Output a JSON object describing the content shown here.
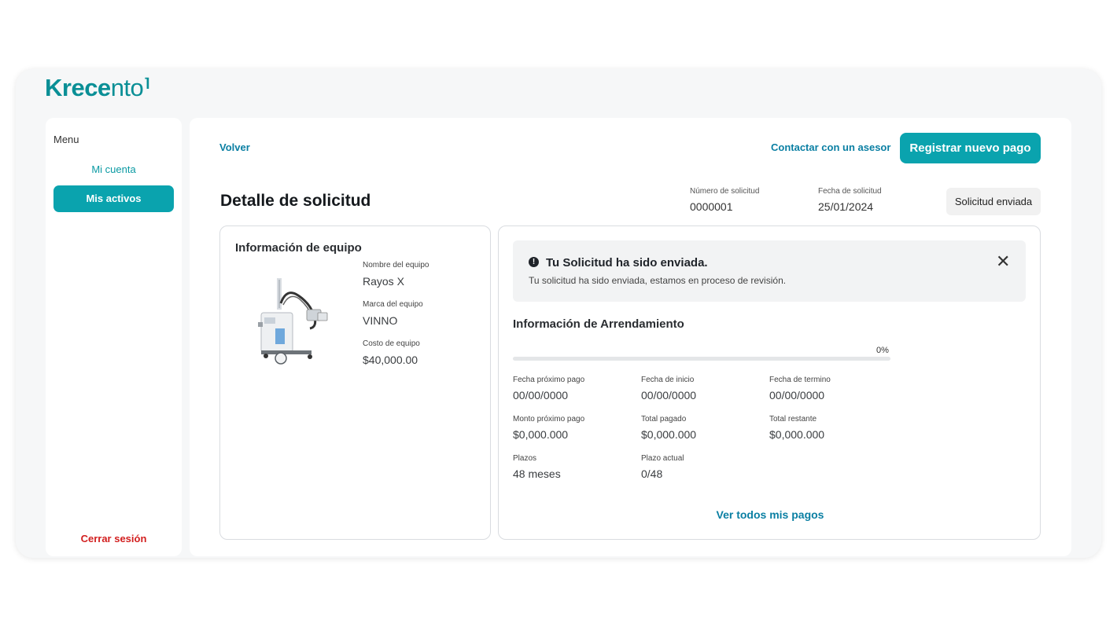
{
  "brand": {
    "bold": "Krece",
    "light": "nto",
    "mark": "⌉"
  },
  "sidebar": {
    "menu_label": "Menu",
    "items": [
      {
        "label": "Mi cuenta",
        "active": false
      },
      {
        "label": "Mis activos",
        "active": true
      }
    ],
    "logout_label": "Cerrar sesión"
  },
  "header": {
    "back_label": "Volver",
    "contact_label": "Contactar con un asesor",
    "primary_button_label": "Registrar nuevo pago",
    "title": "Detalle de solicitud",
    "request_number_label": "Número de solicitud",
    "request_number": "0000001",
    "request_date_label": "Fecha de solicitud",
    "request_date": "25/01/2024",
    "status": "Solicitud enviada"
  },
  "equipment": {
    "title": "Información de equipo",
    "name_label": "Nombre del equipo",
    "name": "Rayos X",
    "brand_label": "Marca del equipo",
    "brand": "VINNO",
    "cost_label": "Costo de equipo",
    "cost": "$40,000.00"
  },
  "lease": {
    "alert_title": "Tu Solicitud ha sido enviada.",
    "alert_body": "Tu solicitud ha sido enviada, estamos en proceso de revisión.",
    "alert_icon": "!",
    "title": "Información de Arrendamiento",
    "progress": 0,
    "progress_text": "0%",
    "fields": {
      "next_payment_date_label": "Fecha próximo pago",
      "next_payment_date": "00/00/0000",
      "start_date_label": "Fecha de inicio",
      "start_date": "00/00/0000",
      "end_date_label": "Fecha de termino",
      "end_date": "00/00/0000",
      "next_payment_amount_label": "Monto próximo pago",
      "next_payment_amount": "$0,000.000",
      "total_paid_label": "Total pagado",
      "total_paid": "$0,000.000",
      "total_remaining_label": "Total restante",
      "total_remaining": "$0,000.000",
      "terms_label": "Plazos",
      "terms": "48 meses",
      "current_term_label": "Plazo actual",
      "current_term": "0/48"
    },
    "see_all_label": "Ver todos mis pagos"
  },
  "colors": {
    "accent": "#0aa3ae",
    "link": "#0a7fa3",
    "danger": "#d21f1f"
  }
}
